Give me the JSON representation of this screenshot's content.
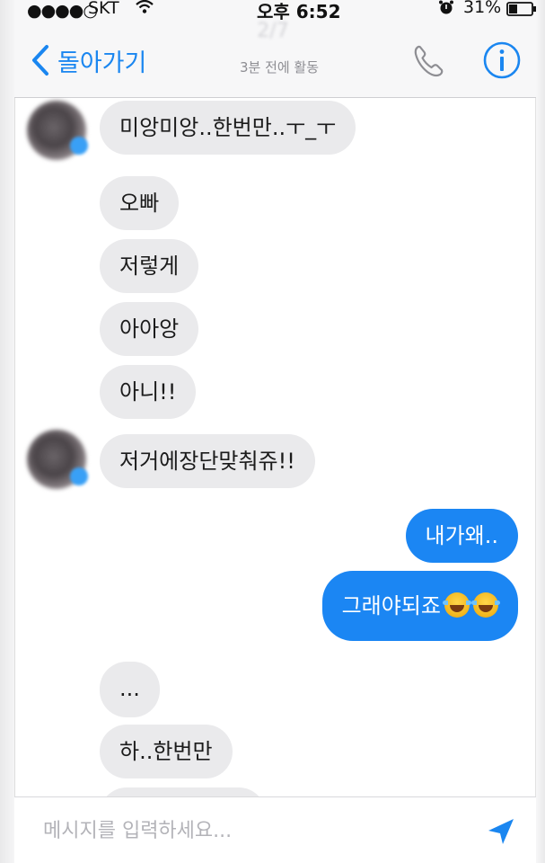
{
  "status_bar": {
    "signal": "●●●●○",
    "carrier": "SKT",
    "time": "오후 6:52",
    "battery": "31%"
  },
  "nav": {
    "back_label": "돌아가기",
    "title": "2/7",
    "subtitle": "3분 전에 활동",
    "icons": [
      "chevron-left-icon",
      "phone-icon",
      "info-icon"
    ]
  },
  "messages": [
    {
      "side": "in",
      "text": "미앙미앙..한번만..ㅜ_ㅜ",
      "avatar": true
    },
    {
      "side": "in",
      "text": "오빠"
    },
    {
      "side": "in",
      "text": "저렇게"
    },
    {
      "side": "in",
      "text": "아아앙"
    },
    {
      "side": "in",
      "text": "아니!!"
    },
    {
      "side": "in",
      "text": "저거에장단맞춰쥬!!",
      "avatar": true
    },
    {
      "side": "out",
      "text": "내가왜.."
    },
    {
      "side": "out",
      "text": "그래야되죠",
      "emoji": [
        "laughing-tears-emoji",
        "laughing-tears-emoji"
      ]
    },
    {
      "side": "in",
      "text": "..."
    },
    {
      "side": "in",
      "text": "하..한번만"
    }
  ],
  "composer": {
    "placeholder": "메시지를 입력하세요...",
    "send_icon": "send-arrow-icon"
  },
  "colors": {
    "accent": "#1a86f0",
    "outgoing_bubble": "#1b86f3",
    "incoming_bubble": "#eaeaec"
  }
}
